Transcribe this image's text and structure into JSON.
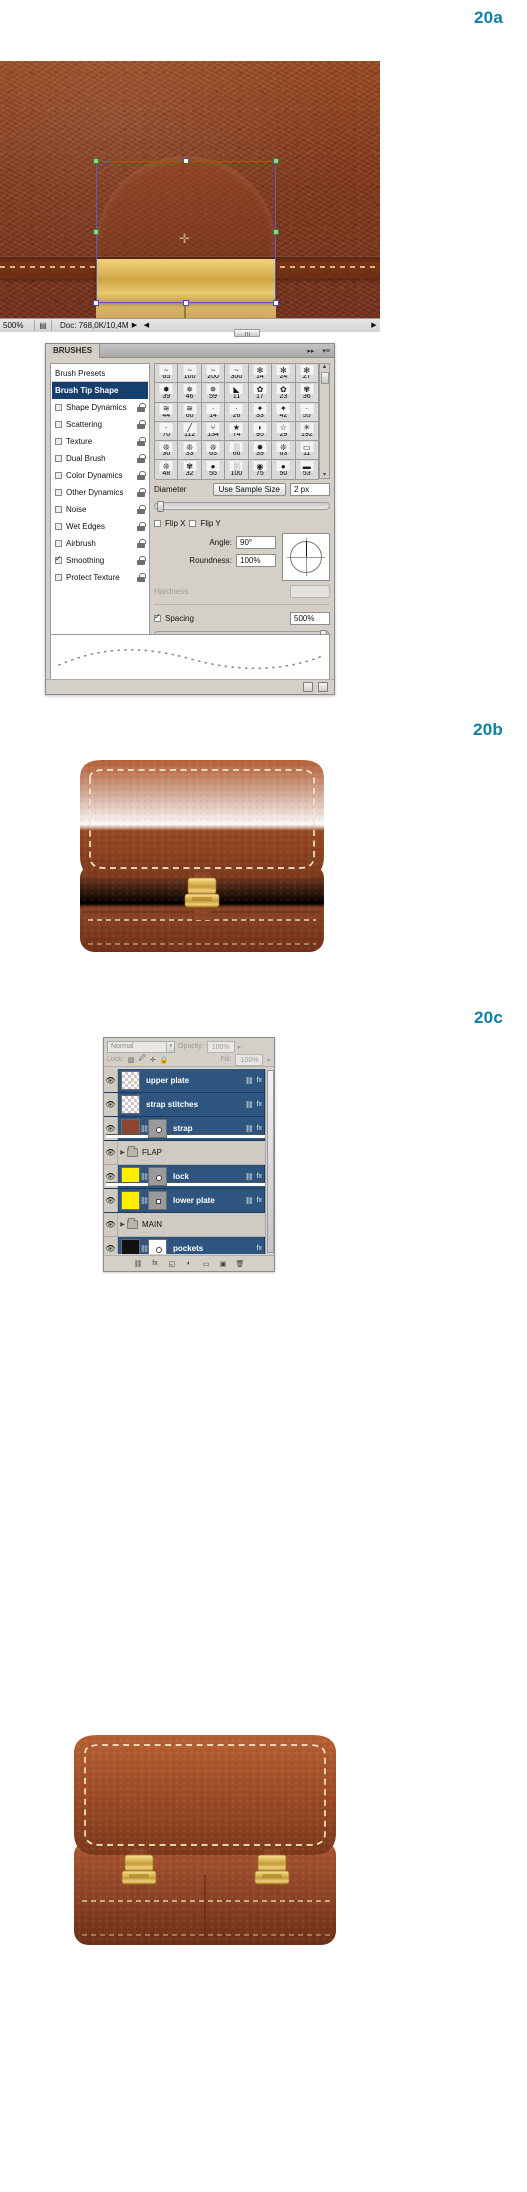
{
  "figures": {
    "a": "20a",
    "b": "20b",
    "c": "20c"
  },
  "photoshop_canvas": {
    "status": {
      "zoom": "500%",
      "doc_icon": "document-icon",
      "doc_info": "Doc: 768,0K/10,4M",
      "play_arrow": "▶",
      "left_arrow": "◀",
      "right_arrow": "▶"
    }
  },
  "brushes_panel": {
    "tab_label": "BRUSHES",
    "collapse_icon": "▸▸",
    "menu_icon": "▾≡",
    "options": [
      {
        "label": "Brush Presets",
        "type": "header",
        "checked": false,
        "lock": false,
        "active": false
      },
      {
        "label": "Brush Tip Shape",
        "type": "item",
        "checked": false,
        "lock": false,
        "active": true
      },
      {
        "label": "Shape Dynamics",
        "type": "checkbox",
        "checked": false,
        "lock": true,
        "active": false
      },
      {
        "label": "Scattering",
        "type": "checkbox",
        "checked": false,
        "lock": true,
        "active": false
      },
      {
        "label": "Texture",
        "type": "checkbox",
        "checked": false,
        "lock": true,
        "active": false
      },
      {
        "label": "Dual Brush",
        "type": "checkbox",
        "checked": false,
        "lock": true,
        "active": false
      },
      {
        "label": "Color Dynamics",
        "type": "checkbox",
        "checked": false,
        "lock": true,
        "active": false
      },
      {
        "label": "Other Dynamics",
        "type": "checkbox",
        "checked": false,
        "lock": true,
        "active": false
      },
      {
        "label": "Noise",
        "type": "checkbox",
        "checked": false,
        "lock": true,
        "active": false
      },
      {
        "label": "Wet Edges",
        "type": "checkbox",
        "checked": false,
        "lock": true,
        "active": false
      },
      {
        "label": "Airbrush",
        "type": "checkbox",
        "checked": false,
        "lock": true,
        "active": false
      },
      {
        "label": "Smoothing",
        "type": "checkbox",
        "checked": true,
        "lock": true,
        "active": false
      },
      {
        "label": "Protect Texture",
        "type": "checkbox",
        "checked": false,
        "lock": true,
        "active": false
      }
    ],
    "brush_grid": {
      "columns": 7,
      "sizes": [
        [
          65,
          100,
          200,
          300,
          14,
          24,
          27
        ],
        [
          39,
          46,
          59,
          11,
          17,
          23,
          36
        ],
        [
          44,
          60,
          14,
          26,
          33,
          42,
          55
        ],
        [
          70,
          112,
          134,
          74,
          95,
          29,
          192
        ],
        [
          36,
          33,
          63,
          66,
          39,
          63,
          11
        ],
        [
          48,
          32,
          55,
          100,
          75,
          50,
          53
        ]
      ],
      "glyphs": [
        [
          "~",
          "~",
          "~",
          "~",
          "✻",
          "✻",
          "✻"
        ],
        [
          "✸",
          "✵",
          "✵",
          "◣",
          "✿",
          "✿",
          "✾"
        ],
        [
          "≋",
          "≋",
          "·",
          "·",
          "✦",
          "✦",
          "·"
        ],
        [
          "·",
          "╱",
          "⑂",
          "★",
          "◗",
          "☆",
          "✳"
        ],
        [
          "❊",
          "❊",
          "❊",
          "░",
          "✸",
          "❊",
          "▭"
        ],
        [
          "❊",
          "✾",
          "●",
          "░",
          "◉",
          "●",
          "▬"
        ]
      ],
      "scroll_up": "▲",
      "scroll_down": "▾"
    },
    "diameter": {
      "label": "Diameter",
      "use_sample_size_button": "Use Sample Size",
      "value": "2 px"
    },
    "flip_x": {
      "label": "Flip X",
      "checked": false
    },
    "flip_y": {
      "label": "Flip Y",
      "checked": false
    },
    "angle": {
      "label": "Angle:",
      "value": "90°"
    },
    "roundness": {
      "label": "Roundness:",
      "value": "100%"
    },
    "hardness": {
      "label": "Hardness",
      "value": "",
      "disabled": true
    },
    "spacing": {
      "label": "Spacing",
      "value": "500%",
      "checked": true
    },
    "footer": {
      "new_brush_icon": "new-brush-icon",
      "delete_brush_icon": "trash-icon"
    }
  },
  "layers_panel": {
    "blend_mode": "Normal",
    "blend_arrow": "▾",
    "opacity_label": "Opacity:",
    "opacity_value": "100%",
    "opacity_arrow": "▸",
    "lock_label": "Lock:",
    "lock_icons": [
      "transparency-lock-icon",
      "paint-lock-icon",
      "move-lock-icon",
      "all-lock-icon"
    ],
    "fill_label": "Fill:",
    "fill_value": "100%",
    "fill_arrow": "▸",
    "eye_icon": "eye-icon",
    "link_icon": "link-icon",
    "fx_icon": "fx-icon",
    "caret_icon": "▾",
    "layers": [
      {
        "name": "upper plate",
        "type": "layer",
        "selected": true,
        "visible": true,
        "thumb": "transparent-dot",
        "mask": null,
        "has_link": true,
        "has_fx": true
      },
      {
        "name": "strap stitches",
        "type": "layer",
        "selected": true,
        "visible": true,
        "thumb": "transparent",
        "mask": null,
        "has_link": true,
        "has_fx": true
      },
      {
        "name": "strap",
        "type": "layer",
        "selected": true,
        "visible": true,
        "thumb": "brown-gradient",
        "mask": "circle",
        "has_link": true,
        "has_fx": true
      },
      {
        "name": "FLAP",
        "type": "group",
        "selected": false,
        "visible": true,
        "thumb": "folder",
        "mask": null,
        "has_link": false,
        "has_fx": false
      },
      {
        "name": "lock",
        "type": "layer",
        "selected": true,
        "visible": true,
        "thumb": "yellow-gradient",
        "mask": "circle",
        "has_link": true,
        "has_fx": true
      },
      {
        "name": "lower plate",
        "type": "layer",
        "selected": true,
        "visible": true,
        "thumb": "yellow",
        "mask": "square",
        "has_link": true,
        "has_fx": true
      },
      {
        "name": "MAIN",
        "type": "group",
        "selected": false,
        "visible": true,
        "thumb": "folder",
        "mask": null,
        "has_link": false,
        "has_fx": false
      },
      {
        "name": "pockets",
        "type": "layer",
        "selected": false,
        "visible": true,
        "thumb": "black",
        "mask": "white",
        "has_link": false,
        "has_fx": true,
        "fx_label": "fx"
      }
    ],
    "footer_icons": [
      "link-layers-icon",
      "fx-icon",
      "mask-icon",
      "adjustment-icon",
      "new-group-icon",
      "new-layer-icon",
      "delete-layer-icon"
    ]
  },
  "colors": {
    "figure_label": "#0d7fa5",
    "leather_brown": "#8a4025",
    "leather_light": "#a9552e",
    "gold": "#dcb council",
    "gold_light": "#f0d27c",
    "gold_dark": "#c79e3e",
    "stitch": "#f0e2bd",
    "panel_gray": "#d4d0c8",
    "layer_selected": "#2d5580"
  }
}
